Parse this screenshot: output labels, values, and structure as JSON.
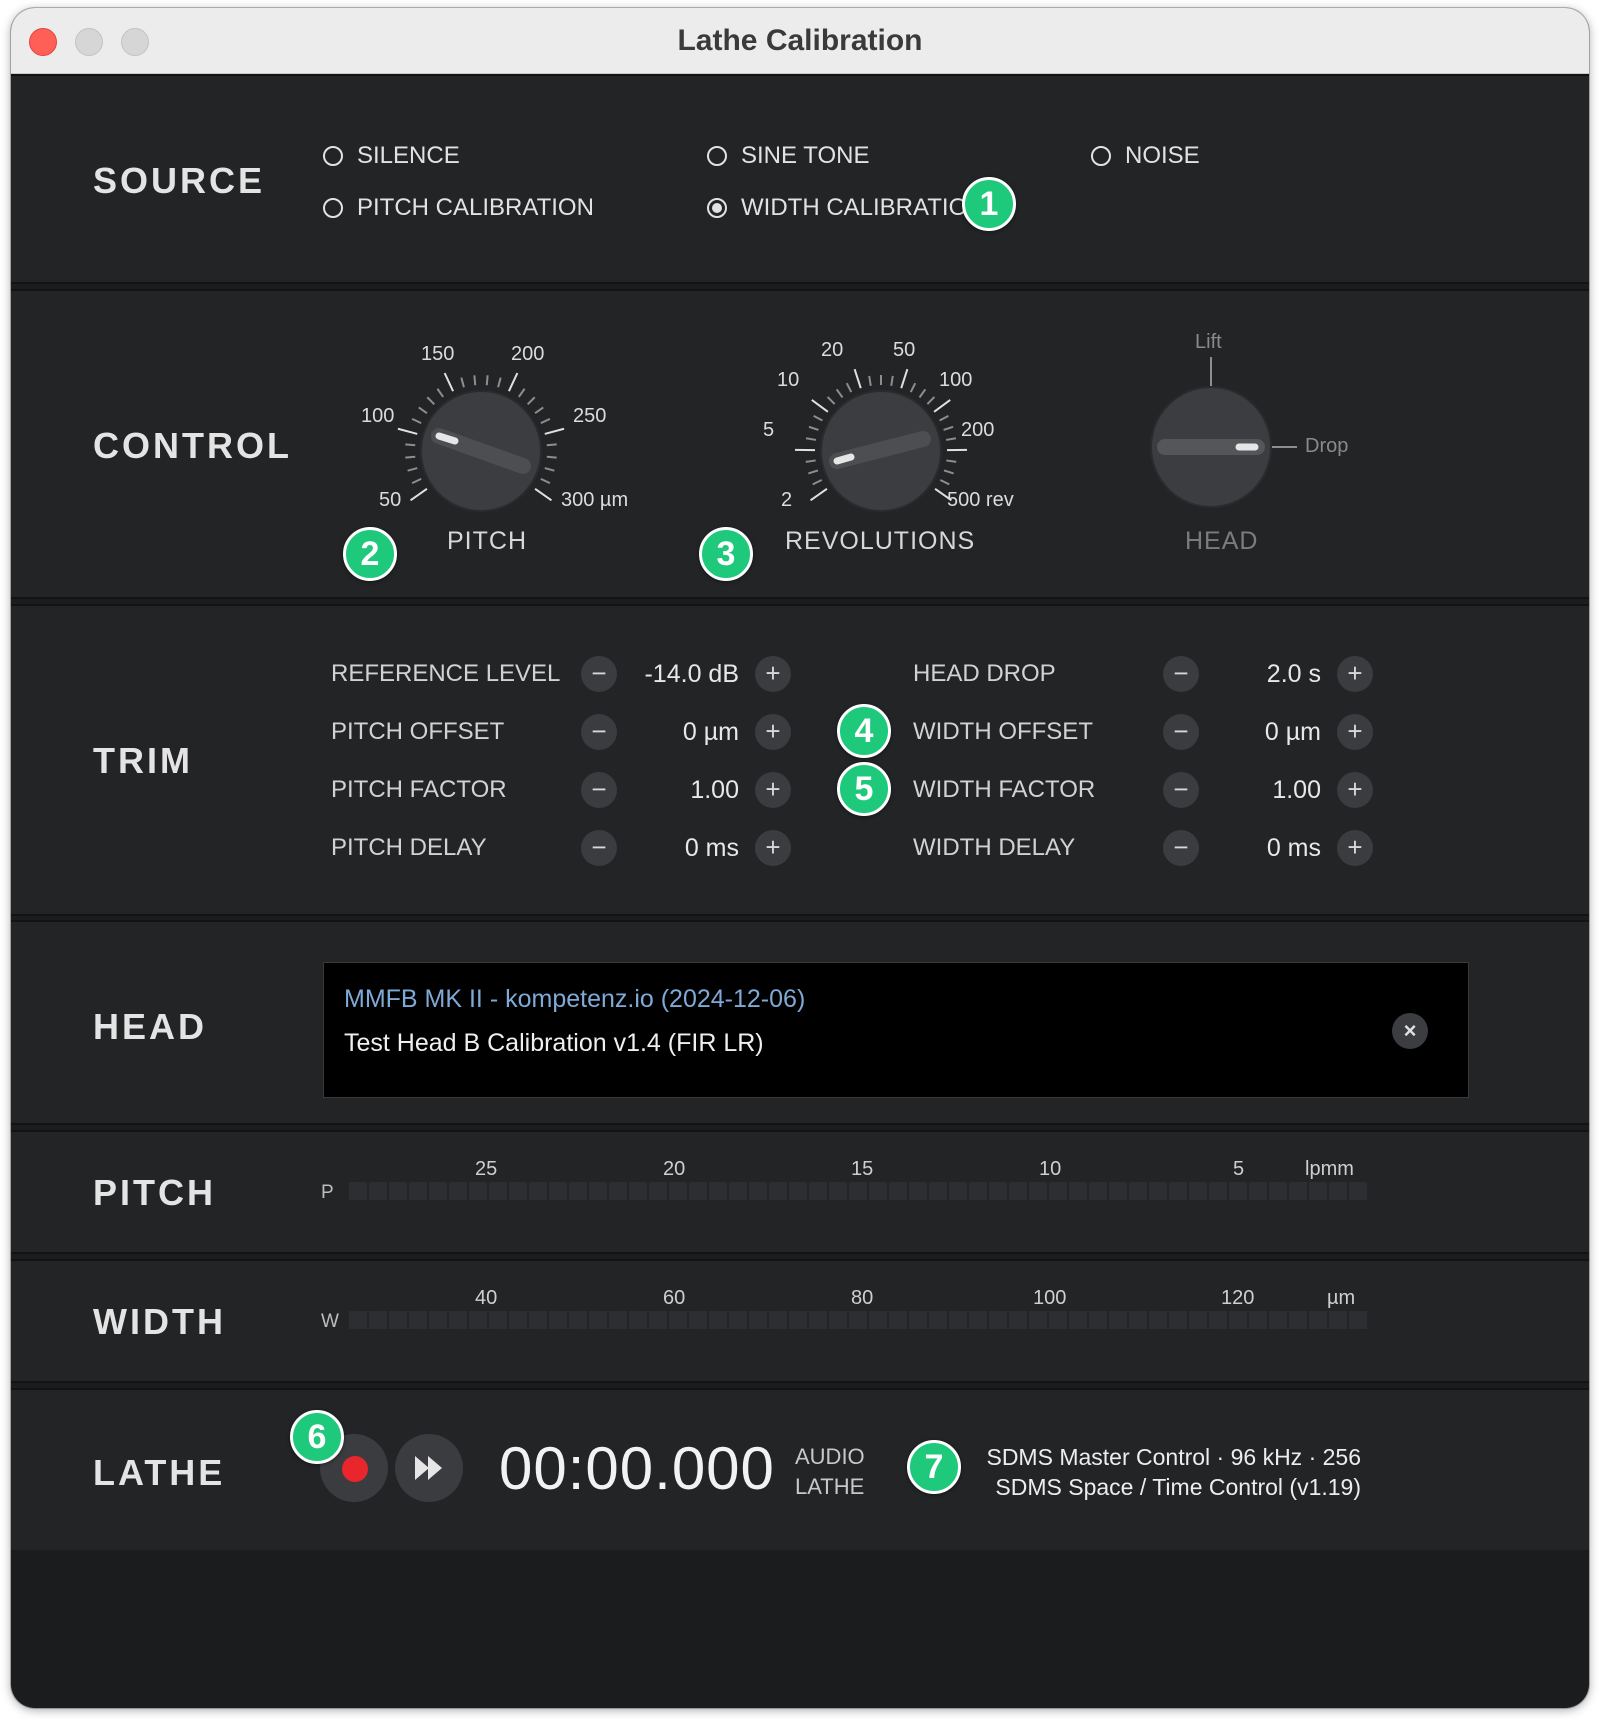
{
  "window": {
    "title": "Lathe Calibration"
  },
  "source": {
    "label": "SOURCE",
    "options": [
      {
        "label": "SILENCE",
        "selected": false
      },
      {
        "label": "SINE TONE",
        "selected": false
      },
      {
        "label": "NOISE",
        "selected": false
      },
      {
        "label": "PITCH CALIBRATION",
        "selected": false
      },
      {
        "label": "WIDTH CALIBRATION",
        "selected": true
      }
    ]
  },
  "control": {
    "label": "CONTROL",
    "pitch": {
      "caption": "PITCH",
      "scale": [
        "50",
        "100",
        "150",
        "200",
        "250",
        "300 µm"
      ]
    },
    "revolutions": {
      "caption": "REVOLUTIONS",
      "scale": [
        "2",
        "5",
        "10",
        "20",
        "50",
        "100",
        "200",
        "500 rev"
      ]
    },
    "head": {
      "caption": "HEAD",
      "lift_label": "Lift",
      "drop_label": "Drop"
    }
  },
  "trim": {
    "label": "TRIM",
    "left": [
      {
        "label": "REFERENCE LEVEL",
        "value": "-14.0 dB"
      },
      {
        "label": "PITCH OFFSET",
        "value": "0 µm"
      },
      {
        "label": "PITCH FACTOR",
        "value": "1.00"
      },
      {
        "label": "PITCH DELAY",
        "value": "0 ms"
      }
    ],
    "right": [
      {
        "label": "HEAD DROP",
        "value": "2.0 s"
      },
      {
        "label": "WIDTH OFFSET",
        "value": "0 µm"
      },
      {
        "label": "WIDTH FACTOR",
        "value": "1.00"
      },
      {
        "label": "WIDTH DELAY",
        "value": "0 ms"
      }
    ],
    "minus": "−",
    "plus": "+"
  },
  "head": {
    "label": "HEAD",
    "link_text": "MMFB MK II - kompetenz.io (2024-12-06)",
    "name": "Test Head B Calibration v1.4 (FIR LR)",
    "clear": "×"
  },
  "pitch_meter": {
    "label": "PITCH",
    "side": "P",
    "ticks": [
      "25",
      "20",
      "15",
      "10",
      "5"
    ],
    "unit": "lpmm"
  },
  "width_meter": {
    "label": "WIDTH",
    "side": "W",
    "ticks": [
      "40",
      "60",
      "80",
      "100",
      "120"
    ],
    "unit": "µm"
  },
  "lathe": {
    "label": "LATHE",
    "time": "00:00.000",
    "mode_line1": "AUDIO",
    "mode_line2": "LATHE",
    "status_line1": "SDMS Master Control · 96 kHz · 256",
    "status_line2": "SDMS Space / Time Control (v1.19)"
  },
  "badges": [
    "1",
    "2",
    "3",
    "4",
    "5",
    "6",
    "7"
  ],
  "colors": {
    "badge": "#1fc97c",
    "record": "#e8262b",
    "link": "#7fa9d6"
  }
}
